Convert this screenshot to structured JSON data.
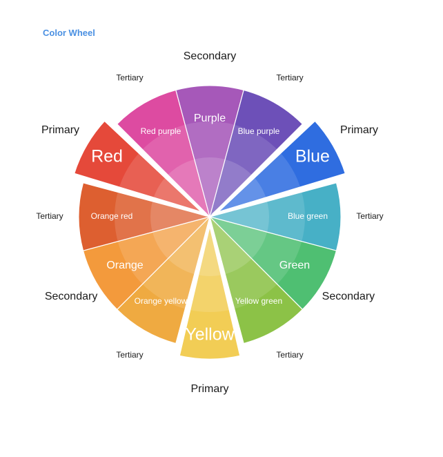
{
  "title": "Color Wheel",
  "segments": [
    {
      "name": "Yellow",
      "category": "Primary",
      "color": "#f2cd55"
    },
    {
      "name": "Orange yellow",
      "category": "Tertiary",
      "color": "#efaa41"
    },
    {
      "name": "Orange",
      "category": "Secondary",
      "color": "#f39a3c"
    },
    {
      "name": "Orange red",
      "category": "Tertiary",
      "color": "#dd5f30"
    },
    {
      "name": "Red",
      "category": "Primary",
      "color": "#e5493a"
    },
    {
      "name": "Red purple",
      "category": "Tertiary",
      "color": "#dd4ba1"
    },
    {
      "name": "Purple",
      "category": "Secondary",
      "color": "#a658b9"
    },
    {
      "name": "Blue purple",
      "category": "Tertiary",
      "color": "#6d50b8"
    },
    {
      "name": "Blue",
      "category": "Primary",
      "color": "#2f6de0"
    },
    {
      "name": "Blue green",
      "category": "Tertiary",
      "color": "#47b0c6"
    },
    {
      "name": "Green",
      "category": "Secondary",
      "color": "#4fbf72"
    },
    {
      "name": "Yellow green",
      "category": "Tertiary",
      "color": "#8cc247"
    }
  ]
}
